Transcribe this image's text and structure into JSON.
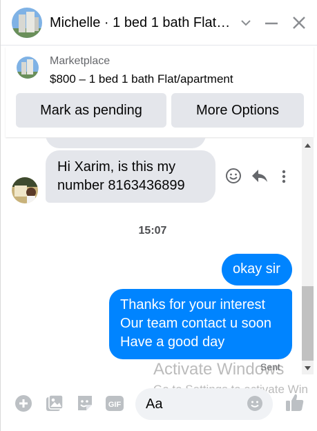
{
  "header": {
    "title": "Michelle · 1 bed 1 bath Flat…"
  },
  "marketplace": {
    "label": "Marketplace",
    "listing_title": "$800 – 1 bed 1 bath Flat/apartment",
    "buttons": {
      "mark_pending": "Mark as pending",
      "more_options": "More Options"
    }
  },
  "messages": [
    {
      "direction": "incoming",
      "lines": [
        "Hi Xarim, is this my",
        "number 8163436899"
      ]
    },
    {
      "direction": "outgoing",
      "lines": [
        "okay sir"
      ]
    },
    {
      "direction": "outgoing",
      "lines": [
        "Thanks for your interest",
        "Our team contact u soon",
        "Have a good day"
      ]
    }
  ],
  "timestamp": "15:07",
  "sent_status": "Sent",
  "composer": {
    "placeholder": "Aa",
    "icons": [
      "plus-icon",
      "photo-icon",
      "sticker-icon",
      "gif-icon",
      "emoji-icon",
      "like-icon"
    ],
    "gif_label": "GIF"
  },
  "watermark": {
    "title": "Activate Windows",
    "subtitle": "Go to Settings to activate Win"
  },
  "colors": {
    "accent": "#0084ff",
    "incoming_bubble": "#e4e6eb",
    "button_bg": "#e4e6eb"
  }
}
